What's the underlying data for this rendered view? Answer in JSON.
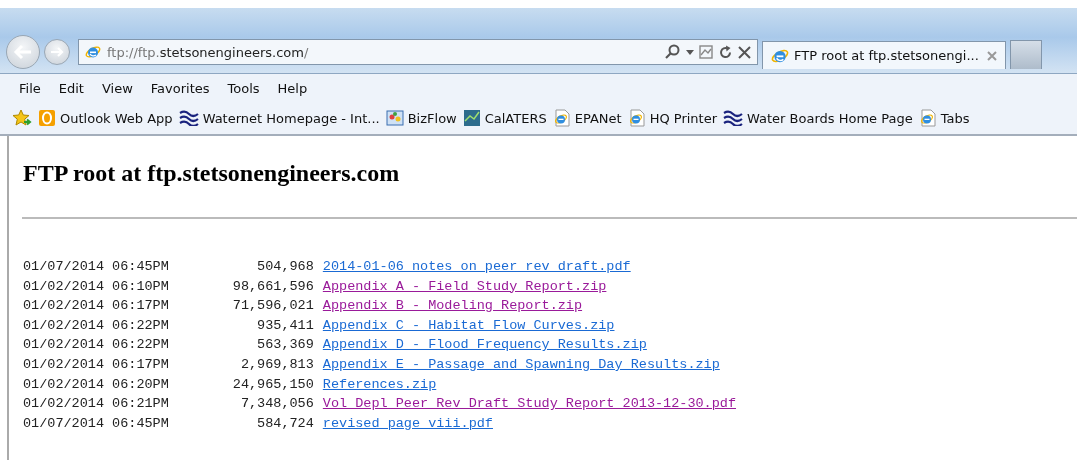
{
  "address_bar": {
    "url_prefix": "ftp://ftp.",
    "url_domain": "stetsonengineers.com",
    "url_suffix": "/"
  },
  "tabs": [
    {
      "title": "FTP root at ftp.stetsonengi...",
      "selected": true
    }
  ],
  "menu": [
    "File",
    "Edit",
    "View",
    "Favorites",
    "Tools",
    "Help"
  ],
  "favorites": [
    {
      "label": "Outlook Web App",
      "kind": "outlook"
    },
    {
      "label": "Waternet Homepage - Int...",
      "kind": "wave"
    },
    {
      "label": "BizFlow",
      "kind": "bizflow"
    },
    {
      "label": "CalATERS",
      "kind": "chart"
    },
    {
      "label": "EPANet",
      "kind": "page"
    },
    {
      "label": "HQ Printer",
      "kind": "page"
    },
    {
      "label": "Water Boards Home Page",
      "kind": "wave"
    },
    {
      "label": "Tabs",
      "kind": "page"
    }
  ],
  "page": {
    "heading": "FTP root at ftp.stetsonengineers.com",
    "files": [
      {
        "date": "01/07/2014 06:45PM",
        "size": "504,968",
        "name": "2014-01-06 notes on peer rev draft.pdf",
        "visited": false
      },
      {
        "date": "01/02/2014 06:10PM",
        "size": "98,661,596",
        "name": "Appendix A - Field Study Report.zip",
        "visited": true
      },
      {
        "date": "01/02/2014 06:17PM",
        "size": "71,596,021",
        "name": "Appendix B - Modeling Report.zip",
        "visited": true
      },
      {
        "date": "01/02/2014 06:22PM",
        "size": "935,411",
        "name": "Appendix C - Habitat Flow Curves.zip",
        "visited": false
      },
      {
        "date": "01/02/2014 06:22PM",
        "size": "563,369",
        "name": "Appendix D - Flood Frequency Results.zip",
        "visited": false
      },
      {
        "date": "01/02/2014 06:17PM",
        "size": "2,969,813",
        "name": "Appendix E - Passage and Spawning Day Results.zip",
        "visited": false
      },
      {
        "date": "01/02/2014 06:20PM",
        "size": "24,965,150",
        "name": "References.zip",
        "visited": false
      },
      {
        "date": "01/02/2014 06:21PM",
        "size": "7,348,056",
        "name": "Vol Depl Peer Rev Draft Study Report 2013-12-30.pdf",
        "visited": true
      },
      {
        "date": "01/07/2014 06:45PM",
        "size": "584,724",
        "name": "revised page viii.pdf",
        "visited": false
      }
    ]
  }
}
